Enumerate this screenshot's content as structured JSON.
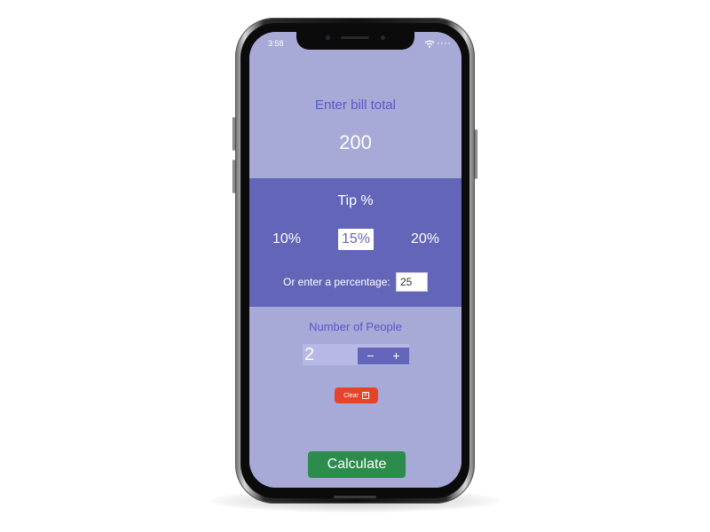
{
  "status_bar": {
    "time": "3:58",
    "wifi_icon": "wifi-icon",
    "signal_icon": "signal-dots-icon"
  },
  "bill": {
    "label": "Enter bill total",
    "value": "200"
  },
  "tip": {
    "title": "Tip %",
    "options": [
      "10%",
      "15%",
      "20%"
    ],
    "selected": "15%",
    "custom_label": "Or enter a percentage:",
    "custom_value": "25"
  },
  "people": {
    "label": "Number of People",
    "value": "2",
    "decrement_label": "−",
    "increment_label": "+"
  },
  "actions": {
    "clear_label": "Clear",
    "clear_icon": "close-box-icon",
    "clear_icon_glyph": "✕",
    "calculate_label": "Calculate"
  },
  "colors": {
    "light_panel": "#a7a9d6",
    "dark_panel": "#6365b9",
    "accent_text": "#5658cc",
    "clear_button": "#e6442a",
    "calculate_button": "#2b8c4c"
  }
}
